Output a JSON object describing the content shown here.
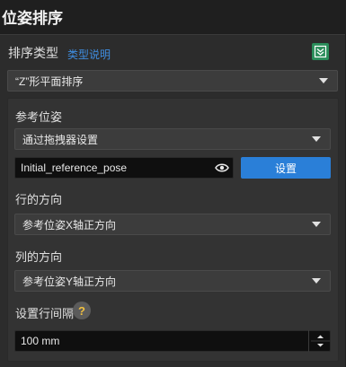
{
  "header": {
    "title": "位姿排序"
  },
  "sort_type": {
    "label": "排序类型",
    "help_link": "类型说明",
    "selected": "“Z”形平面排序"
  },
  "reference_pose": {
    "label": "参考位姿",
    "method_selected": "通过拖拽器设置",
    "pose_name": "Initial_reference_pose",
    "set_button": "设置"
  },
  "row_direction": {
    "label": "行的方向",
    "selected": "参考位姿X轴正方向"
  },
  "column_direction": {
    "label": "列的方向",
    "selected": "参考位姿Y轴正方向"
  },
  "row_spacing": {
    "label": "设置行间隔",
    "help_glyph": "?",
    "value": "100 mm"
  },
  "colors": {
    "accent": "#2a7fd8",
    "link": "#3f8de0",
    "panel": "#2c2c2c"
  }
}
